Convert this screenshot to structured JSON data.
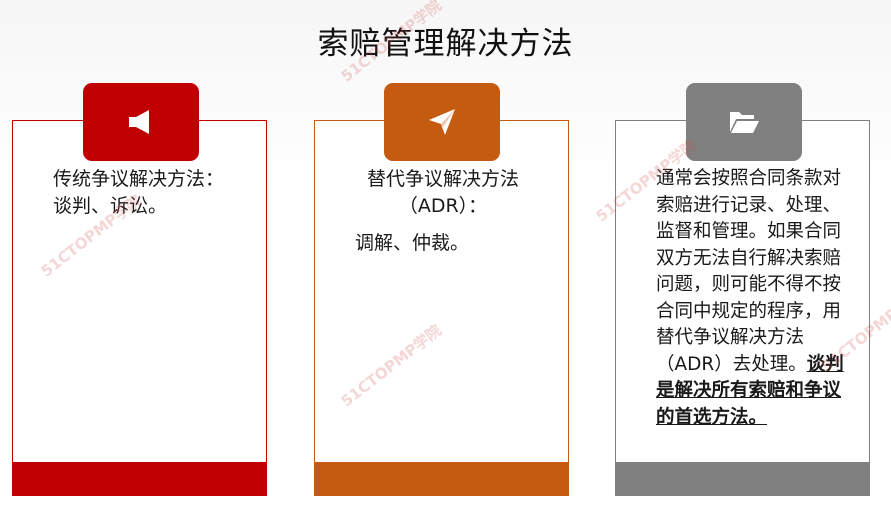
{
  "title": "索赔管理解决方法",
  "watermark": "51CTOPMP学院",
  "colors": {
    "red": "#c00000",
    "orange": "#c55a11",
    "gray": "#808080"
  },
  "cards": [
    {
      "icon": "megaphone-icon",
      "lines": [
        "传统争议解决方法：",
        "谈判、诉讼。"
      ]
    },
    {
      "icon": "paper-plane-icon",
      "lines": [
        "替代争议解决方法",
        "（ADR）："
      ],
      "sub": "调解、仲裁。"
    },
    {
      "icon": "folder-open-icon",
      "body": "通常会按照合同条款对索赔进行记录、处理、监督和管理。如果合同双方无法自行解决索赔问题，则可能不得不按合同中规定的程序，用替代争议解决方法（ADR）去处理。",
      "emphasis": "谈判是解决所有索赔和争议的首选方法。"
    }
  ]
}
